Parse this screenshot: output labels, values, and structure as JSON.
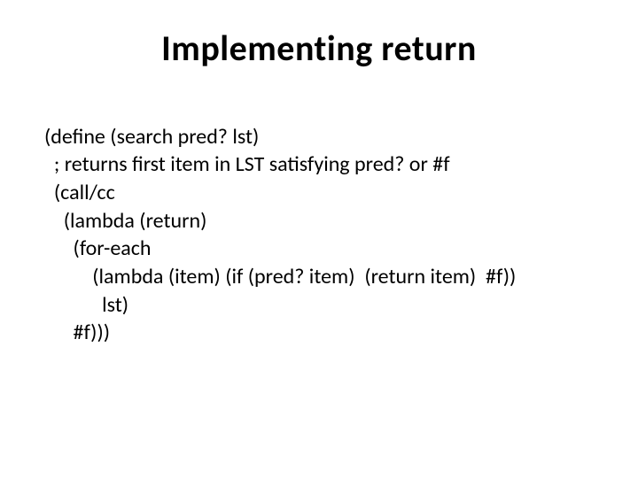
{
  "slide": {
    "title": "Implementing return",
    "code": {
      "l1": "(define (search pred? lst)",
      "l2": "  ; returns first item in LST satisfying pred? or #f",
      "l3": "  (call/cc",
      "l4": "    (lambda (return)",
      "l5": "      (for-each",
      "l6": "          (lambda (item) (if (pred? item)  (return item)  #f))",
      "l7": "            lst)",
      "l8": "      #f)))"
    }
  }
}
